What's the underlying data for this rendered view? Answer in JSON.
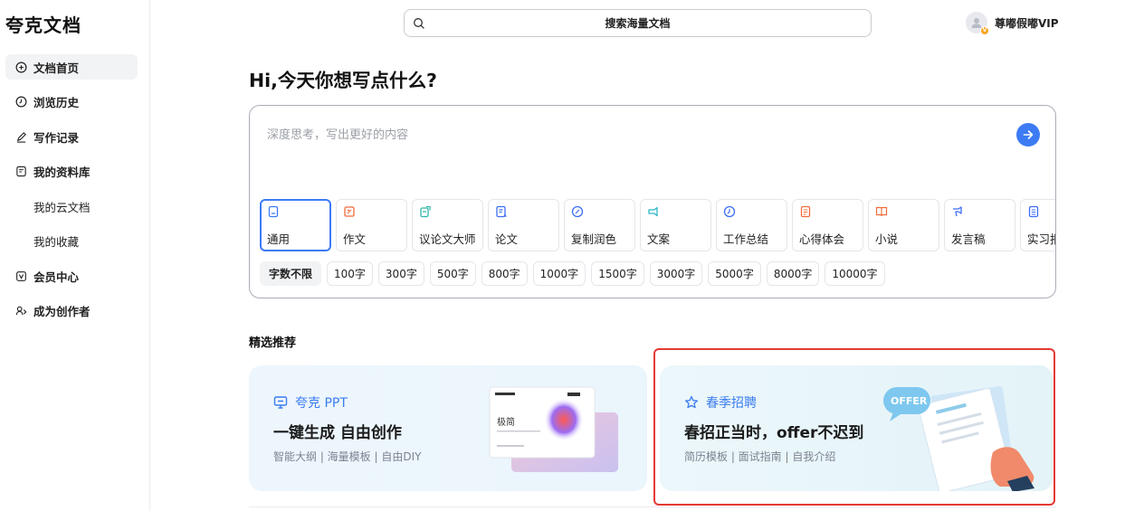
{
  "app": {
    "logo": "夸克文档"
  },
  "sidebar": {
    "items": [
      {
        "label": "文档首页",
        "icon": "home-icon",
        "active": true
      },
      {
        "label": "浏览历史",
        "icon": "clock-icon"
      },
      {
        "label": "写作记录",
        "icon": "pen-icon"
      },
      {
        "label": "我的资料库",
        "icon": "library-icon"
      },
      {
        "label": "我的云文档",
        "sub": true
      },
      {
        "label": "我的收藏",
        "sub": true
      },
      {
        "label": "会员中心",
        "icon": "vip-icon"
      },
      {
        "label": "成为创作者",
        "icon": "creator-icon"
      }
    ]
  },
  "header": {
    "search_text": "搜索海量文档",
    "user_name": "尊嘟假嘟VIP",
    "vip_badge": "V"
  },
  "main": {
    "greeting": "Hi,今天你想写点什么?",
    "compose": {
      "placeholder": "深度思考，写出更好的内容",
      "types": [
        {
          "label": "通用",
          "color": "#3d7bf5",
          "selected": true
        },
        {
          "label": "作文",
          "color": "#f26b3a"
        },
        {
          "label": "议论文大师",
          "color": "#2fb7a8"
        },
        {
          "label": "论文",
          "color": "#3d6ef5"
        },
        {
          "label": "复制润色",
          "color": "#3d6ef5"
        },
        {
          "label": "文案",
          "color": "#2fb7c7"
        },
        {
          "label": "工作总结",
          "color": "#3d6ef5"
        },
        {
          "label": "心得体会",
          "color": "#f26b3a"
        },
        {
          "label": "小说",
          "color": "#f26b3a"
        },
        {
          "label": "发言稿",
          "color": "#3d6ef5"
        },
        {
          "label": "实习报告",
          "color": "#3d6ef5"
        }
      ],
      "word_counts": [
        "字数不限",
        "100字",
        "300字",
        "500字",
        "800字",
        "1000字",
        "1500字",
        "3000字",
        "5000字",
        "8000字",
        "10000字"
      ],
      "selected_word_count": "字数不限"
    },
    "featured": {
      "title": "精选推荐",
      "cards": [
        {
          "tag": "夸克 PPT",
          "title": "一键生成 自由创作",
          "subtitle": "智能大纲 | 海量模板 | 自由DIY",
          "image_text": "极简"
        },
        {
          "tag": "春季招聘",
          "title": "春招正当时，offer不迟到",
          "subtitle": "简历模板 | 面试指南 | 自我介绍",
          "image_text": "OFFER"
        }
      ]
    }
  },
  "colors": {
    "accent": "#3d7bf5",
    "highlight": "#e53935"
  }
}
